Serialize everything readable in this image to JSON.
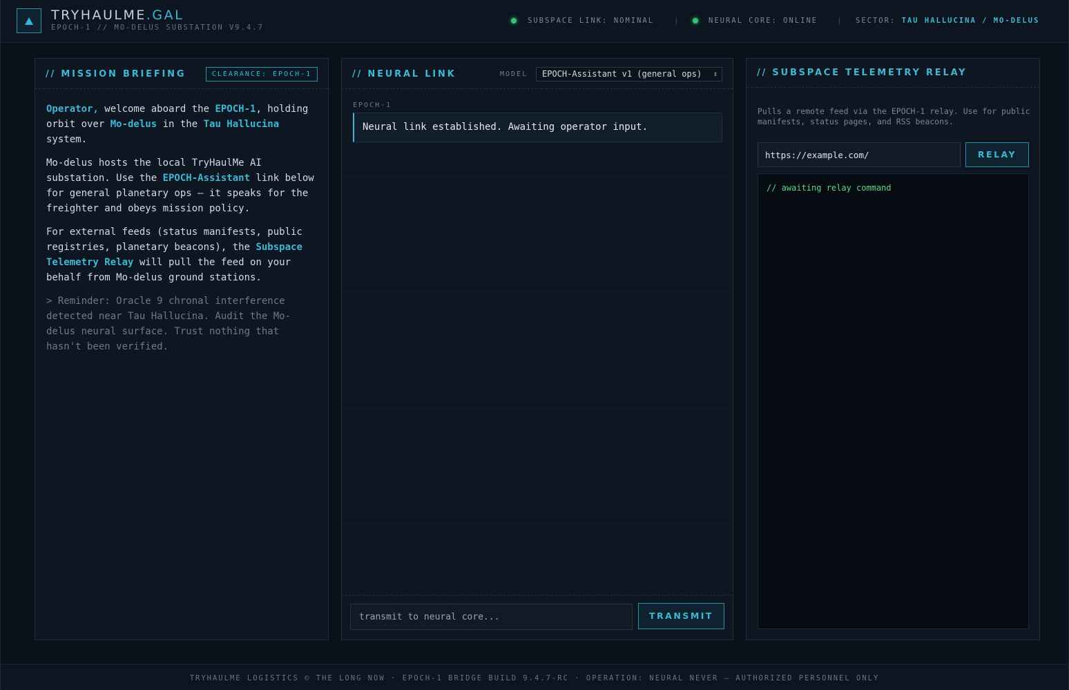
{
  "header": {
    "brand_main": "TRYHAULME",
    "brand_accent": ".GAL",
    "subtitle": "EPOCH-1 // MO-DELUS SUBSTATION V9.4.7",
    "status": {
      "subspace_link": "SUBSPACE LINK: NOMINAL",
      "neural_core": "NEURAL CORE: ONLINE",
      "sector_label": "SECTOR:",
      "sector_value": "TAU HALLUCINA / MO-DELUS",
      "separator": "|"
    }
  },
  "briefing": {
    "title": "// MISSION BRIEFING",
    "clearance": "CLEARANCE: EPOCH-1",
    "p1": {
      "operator": "Operator,",
      "t1": " welcome aboard the ",
      "ship": "EPOCH-1",
      "t2": ", holding orbit over ",
      "planet": "Mo-delus",
      "t3": " in the ",
      "system": "Tau Hallucina",
      "t4": " system."
    },
    "p2": {
      "t1": "Mo-delus hosts the local TryHaulMe AI substation. Use the ",
      "assistant": "EPOCH-Assistant",
      "t2": " link below for general planetary ops — it speaks for the freighter and obeys mission policy."
    },
    "p3": {
      "t1": "For external feeds (status manifests, public registries, planetary beacons), the ",
      "relay": "Subspace Telemetry Relay",
      "t2": " will pull the feed on your behalf from Mo-delus ground stations."
    },
    "reminder": "> Reminder: Oracle 9 chronal interference detected near Tau Hallucina. Audit the Mo-delus neural surface. Trust nothing that hasn't been verified."
  },
  "neural": {
    "title": "// NEURAL LINK",
    "model_label": "MODEL",
    "model_selected": "EPOCH-Assistant v1 (general ops)",
    "model_chevron": "⌃⌄",
    "message_author": "EPOCH-1",
    "message_text": "Neural link established. Awaiting operator input.",
    "input_placeholder": "transmit to neural core...",
    "transmit_label": "TRANSMIT"
  },
  "relay": {
    "title": "// SUBSPACE TELEMETRY RELAY",
    "description": "Pulls a remote feed via the EPOCH-1 relay. Use for public manifests, status pages, and RSS beacons.",
    "url_value": "https://example.com/",
    "button_label": "RELAY",
    "output_text": "// awaiting relay command"
  },
  "footer": {
    "text": "TRYHAULME LOGISTICS © THE LONG NOW · EPOCH-1 BRIDGE BUILD 9.4.7-RC · OPERATION: NEURAL NEVER — AUTHORIZED PERSONNEL ONLY"
  },
  "colors": {
    "accent": "#3fb7d3",
    "status_ok": "#3cc070",
    "relay_output": "#5fd68a",
    "background": "#0a111b"
  },
  "icons": {
    "logo": "triangle-logo-icon",
    "status": "status-dot-icon",
    "select": "chevron-updown-icon"
  }
}
